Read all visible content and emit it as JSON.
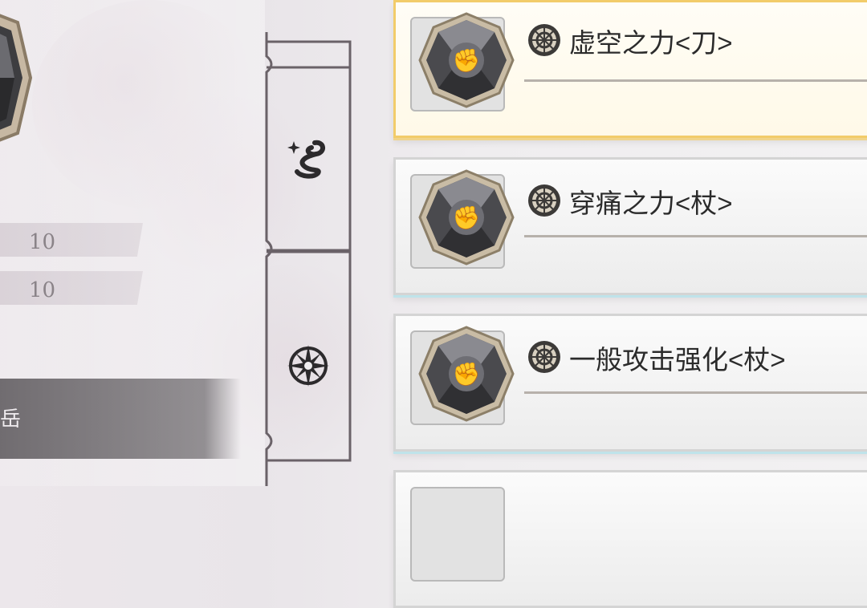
{
  "left_panel": {
    "stats": [
      {
        "value": "10"
      },
      {
        "value": "10"
      }
    ],
    "dark_bar_text": "岳"
  },
  "tabs": [
    {
      "icon": "dragon-icon"
    },
    {
      "icon": "compass-star-icon"
    }
  ],
  "skills": [
    {
      "name": "虚空之力<刀>",
      "selected": true,
      "icon": "fist-gem-icon"
    },
    {
      "name": "穿痛之力<杖>",
      "selected": false,
      "icon": "fist-gem-icon"
    },
    {
      "name": "一般攻击强化<杖>",
      "selected": false,
      "icon": "fist-gem-icon"
    }
  ],
  "colors": {
    "selected_border": "#f2cc6a",
    "card_underline": "#b7b1ab",
    "tab_outline": "#5c545a"
  }
}
